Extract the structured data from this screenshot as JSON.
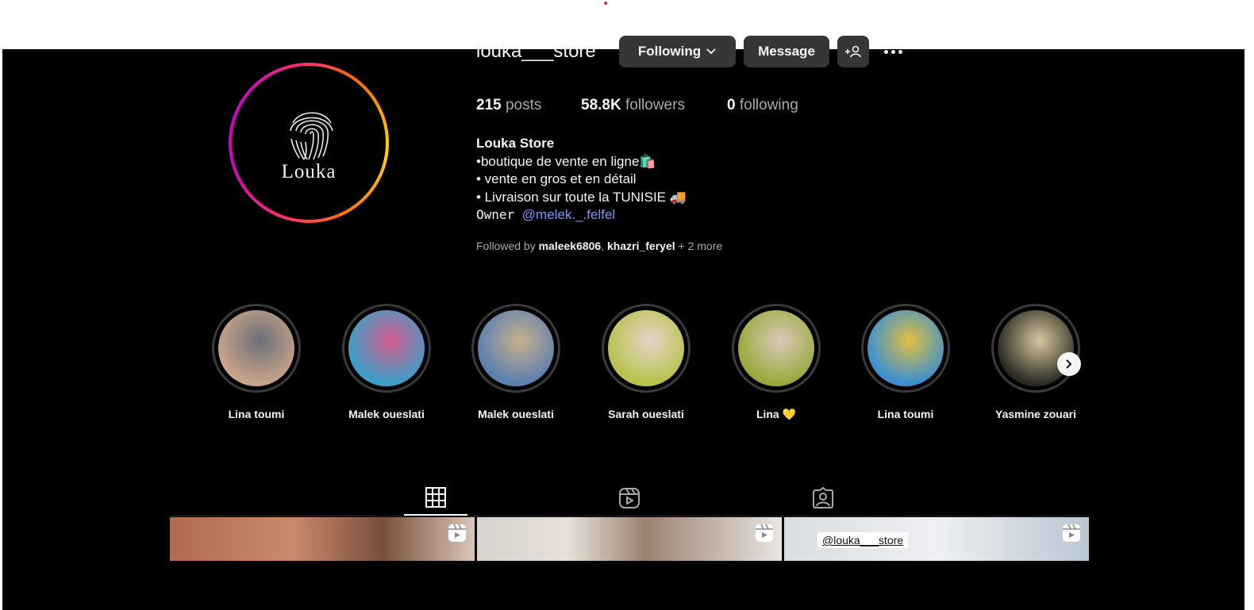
{
  "profile": {
    "username": "louka___store",
    "logo_text": "Louka",
    "buttons": {
      "following": "Following",
      "message": "Message"
    },
    "stats": {
      "posts_count": "215",
      "posts_label": "posts",
      "followers_count": "58.8K",
      "followers_label": "followers",
      "following_count": "0",
      "following_label": "following"
    },
    "bio": {
      "name": "Louka Store",
      "line1": "•boutique de vente en ligne🛍️",
      "line2": "• vente en gros et en détail",
      "line3": "• Livraison sur toute la TUNISIE 🚚",
      "owner_prefix": "Owner ",
      "owner_handle": "@melek._.felfel"
    },
    "followed_by": {
      "prefix": "Followed by ",
      "user1": "maleek6806",
      "separator": ", ",
      "user2": "khazri_feryel",
      "more": " + 2 more"
    }
  },
  "highlights": [
    {
      "label": "Lina toumi",
      "c1": "#c9a48a",
      "c2": "#6b6f78"
    },
    {
      "label": "Malek oueslati",
      "c1": "#3aa0c8",
      "c2": "#d45a8a"
    },
    {
      "label": "Malek oueslati",
      "c1": "#5a7fb0",
      "c2": "#c7b08a"
    },
    {
      "label": "Sarah oueslati",
      "c1": "#b9c24a",
      "c2": "#e3d5c9"
    },
    {
      "label": "Lina 💛",
      "c1": "#9aa83a",
      "c2": "#d9c9b9"
    },
    {
      "label": "Lina toumi",
      "c1": "#3a8fd0",
      "c2": "#e0c040"
    },
    {
      "label": "Yasmine zouari",
      "c1": "#2a2a20",
      "c2": "#d8c8a0"
    }
  ],
  "grid": {
    "watermark": "@louka___store"
  },
  "colors": {
    "background": "#000000",
    "button": "#363636",
    "link": "#7896ff",
    "secondary_text": "#a8a8a8"
  }
}
